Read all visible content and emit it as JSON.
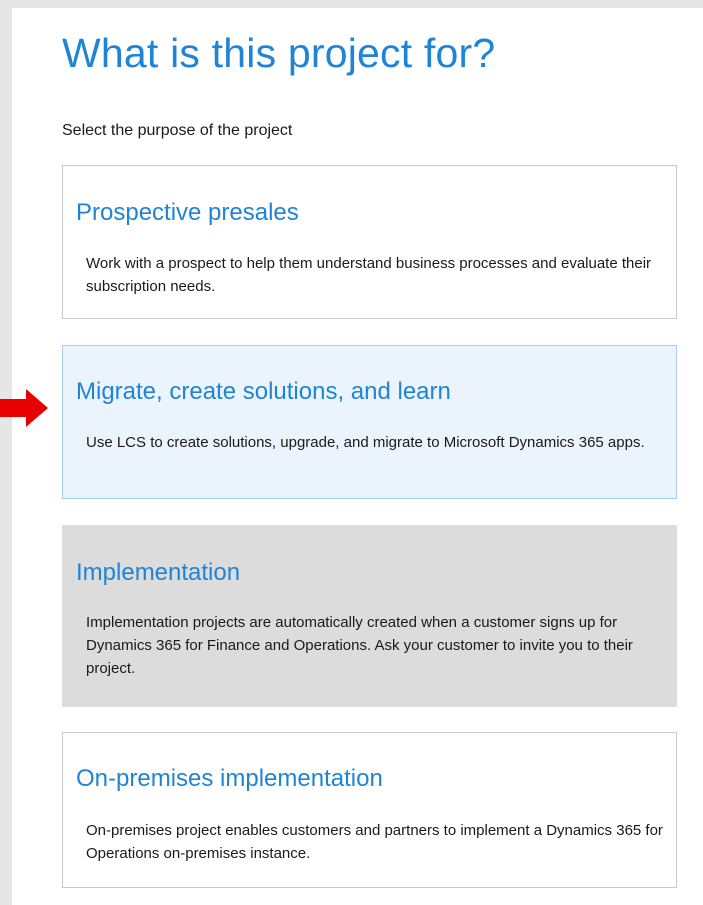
{
  "page": {
    "title": "What is this project for?",
    "subtitle": "Select the purpose of the project"
  },
  "options": [
    {
      "title": "Prospective presales",
      "description": "Work with a prospect to help them understand business processes and evaluate their subscription needs.",
      "state": "default"
    },
    {
      "title": "Migrate, create solutions, and learn",
      "description": "Use LCS to create solutions, upgrade, and migrate to Microsoft Dynamics 365 apps.",
      "state": "highlighted"
    },
    {
      "title": "Implementation",
      "description": "Implementation projects are automatically created when a customer signs up for Dynamics 365 for Finance and Operations. Ask your customer to invite you to their project.",
      "state": "disabled"
    },
    {
      "title": "On-premises implementation",
      "description": "On-premises project enables customers and partners to implement a Dynamics 365 for Operations on-premises instance.",
      "state": "default"
    }
  ],
  "colors": {
    "accent": "#1f84d6",
    "arrow": "#e60000",
    "highlight_bg": "#ebf4fd",
    "disabled_bg": "#dcdcdc"
  },
  "annotation": {
    "icon": "red-arrow-icon"
  }
}
